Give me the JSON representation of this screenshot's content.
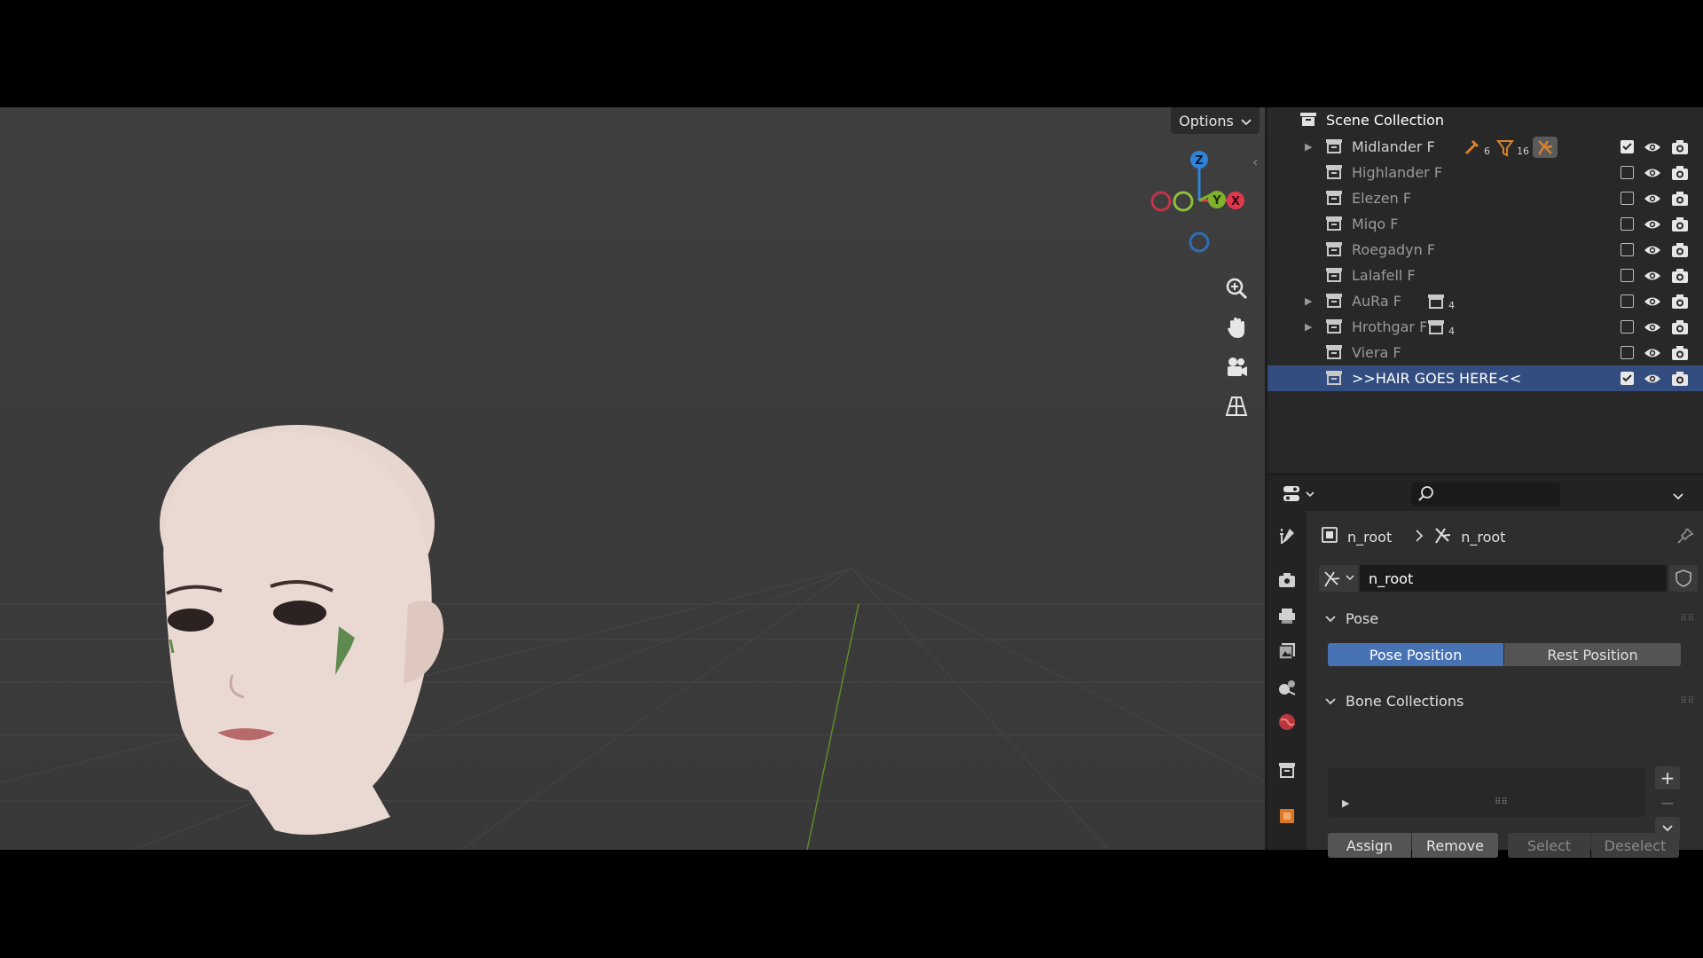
{
  "viewport": {
    "options_label": "Options",
    "gizmo_axes": {
      "z": "Z",
      "y": "Y",
      "x": "X"
    },
    "colors": {
      "x": "#e0384f",
      "y": "#7fb02e",
      "z": "#2f84d8"
    },
    "tools": [
      "zoom-icon",
      "pan-hand-icon",
      "camera-icon",
      "perspective-grid-icon"
    ]
  },
  "outliner": {
    "root_label": "Scene Collection",
    "items": [
      {
        "label": "Midlander F",
        "expandable": true,
        "checked": true,
        "badges": [
          "6",
          "16"
        ]
      },
      {
        "label": "Highlander F",
        "expandable": false,
        "checked": false
      },
      {
        "label": "Elezen F",
        "expandable": false,
        "checked": false
      },
      {
        "label": "Miqo F",
        "expandable": false,
        "checked": false
      },
      {
        "label": "Roegadyn F",
        "expandable": false,
        "checked": false
      },
      {
        "label": "Lalafell F",
        "expandable": false,
        "checked": false
      },
      {
        "label": "AuRa F",
        "expandable": true,
        "checked": false,
        "badges": [
          "4"
        ]
      },
      {
        "label": "Hrothgar F",
        "expandable": true,
        "checked": false,
        "badges": [
          "4"
        ]
      },
      {
        "label": "Viera F",
        "expandable": false,
        "checked": false
      },
      {
        "label": ">>HAIR GOES HERE<<",
        "expandable": false,
        "checked": true,
        "selected": true
      }
    ]
  },
  "properties": {
    "breadcrumb": {
      "object": "n_root",
      "data": "n_root"
    },
    "armature_name": "n_root",
    "pose_panel": {
      "title": "Pose",
      "pose_position_label": "Pose Position",
      "rest_position_label": "Rest Position"
    },
    "bone_collections_panel": {
      "title": "Bone Collections",
      "add_label": "+",
      "remove_label": "−",
      "assign_label": "Assign",
      "remove_btn_label": "Remove",
      "select_label": "Select",
      "deselect_label": "Deselect"
    }
  }
}
